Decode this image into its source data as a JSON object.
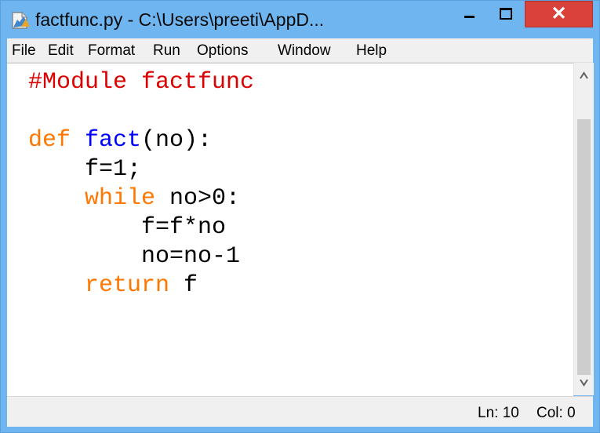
{
  "window": {
    "title": "factfunc.py - C:\\Users\\preeti\\AppD...",
    "close_label": "✕",
    "titlebar_color": "#6fb5ef",
    "close_color": "#d9413b"
  },
  "menu": {
    "items": [
      "File",
      "Edit",
      "Format",
      "Run",
      "Options",
      "Window",
      "Help"
    ]
  },
  "editor": {
    "lines": [
      {
        "tokens": [
          {
            "text": "#Module factfunc",
            "style": "comment"
          }
        ]
      },
      {
        "tokens": []
      },
      {
        "tokens": [
          {
            "text": "def",
            "style": "keyword"
          },
          {
            "text": " ",
            "style": "text"
          },
          {
            "text": "fact",
            "style": "definition"
          },
          {
            "text": "(no):",
            "style": "text"
          }
        ]
      },
      {
        "tokens": [
          {
            "text": "    f=1;",
            "style": "text"
          }
        ]
      },
      {
        "tokens": [
          {
            "text": "    ",
            "style": "text"
          },
          {
            "text": "while",
            "style": "keyword"
          },
          {
            "text": " no>0:",
            "style": "text"
          }
        ]
      },
      {
        "tokens": [
          {
            "text": "        f=f*no",
            "style": "text"
          }
        ]
      },
      {
        "tokens": [
          {
            "text": "        no=no-1",
            "style": "text"
          }
        ]
      },
      {
        "tokens": [
          {
            "text": "    ",
            "style": "text"
          },
          {
            "text": "return",
            "style": "keyword"
          },
          {
            "text": " f",
            "style": "text"
          }
        ]
      }
    ],
    "colors": {
      "comment": "#dd0000",
      "keyword": "#ff7700",
      "definition": "#0000ff",
      "text": "#000000"
    }
  },
  "status": {
    "line": "Ln: 10",
    "col": "Col: 0"
  },
  "icons": {
    "app": "idle-file-icon",
    "minimize": "minimize-icon",
    "maximize": "maximize-icon",
    "close": "close-icon",
    "scroll_up": "chevron-up-icon",
    "scroll_down": "chevron-down-icon"
  }
}
